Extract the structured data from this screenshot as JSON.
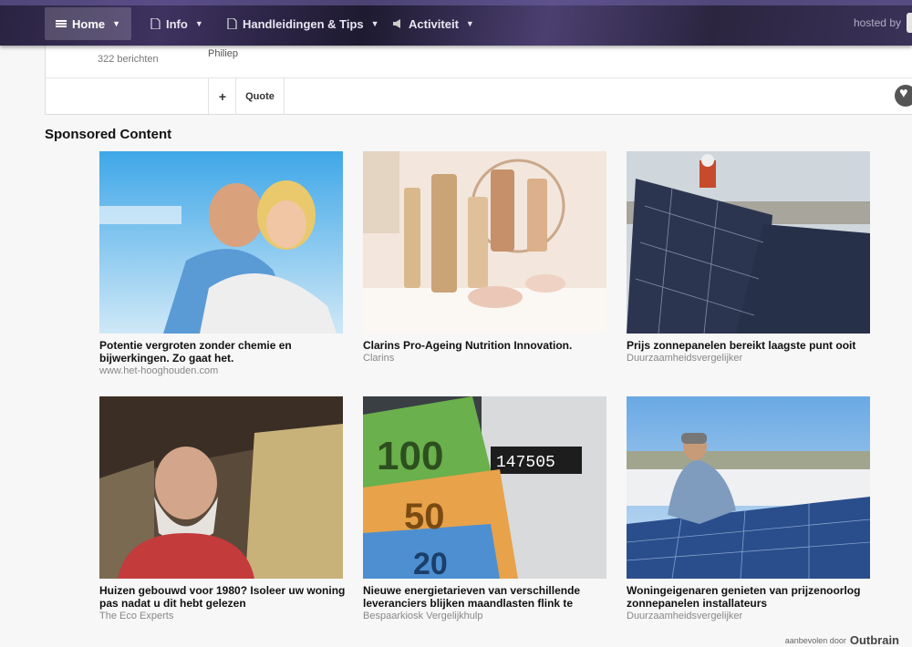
{
  "nav": {
    "items": [
      {
        "label": "Home",
        "icon": "menu-icon",
        "active": true
      },
      {
        "label": "Info",
        "icon": "document-icon",
        "active": false
      },
      {
        "label": "Handleidingen & Tips",
        "icon": "document-icon",
        "active": false
      },
      {
        "label": "Activiteit",
        "icon": "megaphone-icon",
        "active": false
      }
    ],
    "hosted": "hosted by"
  },
  "post": {
    "count": "322 berichten",
    "author": "Philiep",
    "plus_label": "+",
    "quote_label": "Quote"
  },
  "sponsored": {
    "title": "Sponsored Content",
    "cards": [
      {
        "title": "Potentie vergroten zonder chemie en bijwerkingen. Zo gaat het.",
        "source": "www.het-hooghouden.com"
      },
      {
        "title": "Clarins Pro-Ageing Nutrition Innovation.",
        "source": "Clarins"
      },
      {
        "title": "Prijs zonnepanelen bereikt laagste punt ooit",
        "source": "Duurzaamheidsvergelijker"
      },
      {
        "title": "Huizen gebouwd voor 1980? Isoleer uw woning pas nadat u dit hebt gelezen",
        "source": "The Eco Experts"
      },
      {
        "title": "Nieuwe energietarieven van verschillende leveranciers blijken maandlasten flink te kunnen verlagen",
        "source": "Bespaarkiosk Vergelijkhulp"
      },
      {
        "title": "Woningeigenaren genieten van prijzenoorlog zonnepanelen installateurs",
        "source": "Duurzaamheidsvergelijker"
      }
    ]
  },
  "footer": {
    "recommended": "aanbevolen door",
    "brand": "Outbrain"
  }
}
